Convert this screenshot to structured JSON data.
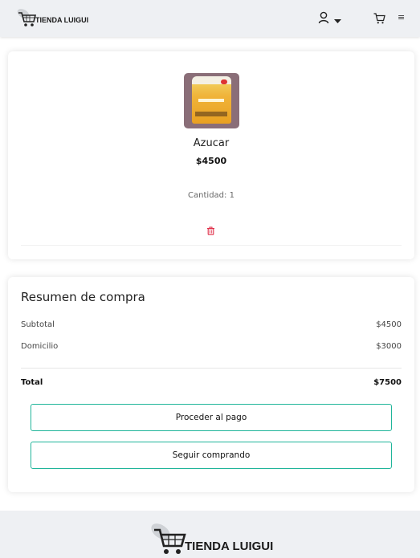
{
  "header": {
    "brand": "TIENDA LUIGUI",
    "icons": {
      "user": "user-icon",
      "caret": "caret-down-icon",
      "cart": "cart-icon",
      "menu": "menu-icon"
    },
    "menu_glyph": "≡"
  },
  "cart": {
    "items": [
      {
        "name": "Azucar",
        "price": "$4500",
        "quantity_text": "Cantidad: 1",
        "delete_icon": "trash-icon"
      }
    ]
  },
  "summary": {
    "title": "Resumen de compra",
    "subtotal_label": "Subtotal",
    "subtotal_value": "$4500",
    "delivery_label": "Domicilio",
    "delivery_value": "$3000",
    "total_label": "Total",
    "total_value": "$7500",
    "pay_button": "Proceder al pago",
    "continue_button": "Seguir comprando"
  },
  "footer": {
    "brand": "TIENDA LUIGUI"
  },
  "colors": {
    "accent": "#20b59a",
    "delete": "#e0304a",
    "header_bg": "#eef0f3"
  }
}
